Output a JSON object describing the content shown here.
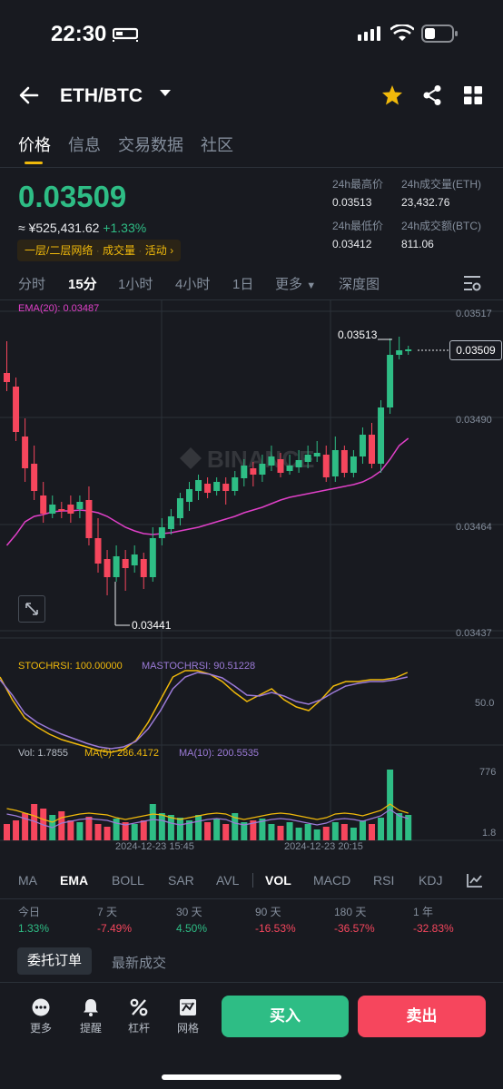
{
  "status_bar": {
    "time": "22:30"
  },
  "header": {
    "pair": "ETH/BTC"
  },
  "tabs": [
    "价格",
    "信息",
    "交易数据",
    "社区"
  ],
  "price": {
    "last": "0.03509",
    "cny": "≈ ¥525,431.62",
    "change": "+1.33%",
    "tags": [
      "一层/二层网络",
      "成交量",
      "活动"
    ]
  },
  "stats": {
    "high_label": "24h最高价",
    "high": "0.03513",
    "vol_eth_label": "24h成交量(ETH)",
    "vol_eth": "23,432.76",
    "low_label": "24h最低价",
    "low": "0.03412",
    "vol_btc_label": "24h成交额(BTC)",
    "vol_btc": "811.06"
  },
  "timeframes": [
    "分时",
    "15分",
    "1小时",
    "4小时",
    "1日",
    "更多",
    "深度图"
  ],
  "main_chart": {
    "ema_label": "EMA(20): 0.03487",
    "y_ticks": [
      "0.03517",
      "0.03490",
      "0.03464",
      "0.03437"
    ],
    "high_marker": "0.03513",
    "low_marker": "0.03441",
    "last_price_tag": "0.03509",
    "watermark": "BINANCE"
  },
  "stochrsi": {
    "label": "STOCHRSI: 100.00000",
    "ma_label": "MASTOCHRSI: 90.51228",
    "tick": "50.0"
  },
  "volume": {
    "label": "Vol: 1.7855",
    "ma5": "MA(5): 286.4172",
    "ma10": "MA(10): 200.5535",
    "tick_top": "776",
    "tick_bottom": "1.8"
  },
  "x_labels": [
    "2024-12-23 15:45",
    "2024-12-23 20:15"
  ],
  "indicators": [
    "MA",
    "EMA",
    "BOLL",
    "SAR",
    "AVL",
    "VOL",
    "MACD",
    "RSI",
    "KDJ"
  ],
  "performance": [
    {
      "label": "今日",
      "value": "1.33%",
      "dir": "up"
    },
    {
      "label": "7 天",
      "value": "-7.49%",
      "dir": "down"
    },
    {
      "label": "30 天",
      "value": "4.50%",
      "dir": "up"
    },
    {
      "label": "90 天",
      "value": "-16.53%",
      "dir": "down"
    },
    {
      "label": "180 天",
      "value": "-36.57%",
      "dir": "down"
    },
    {
      "label": "1 年",
      "value": "-32.83%",
      "dir": "down"
    }
  ],
  "order_tabs": [
    "委托订单",
    "最新成交"
  ],
  "bottom": {
    "items": [
      "更多",
      "提醒",
      "杠杆",
      "网格"
    ],
    "buy": "买入",
    "sell": "卖出"
  },
  "colors": {
    "up": "#2ebd85",
    "down": "#f6465d",
    "accent": "#f0b90b",
    "ema": "#e040c8",
    "ma10": "#9c7bd8"
  }
}
